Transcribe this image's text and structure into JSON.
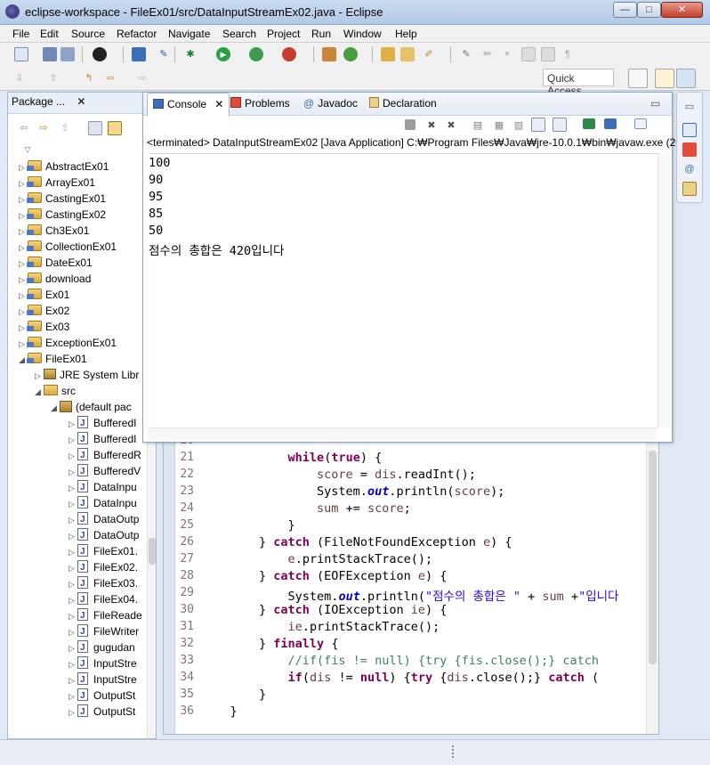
{
  "window": {
    "title": "eclipse-workspace - FileEx01/src/DataInputStreamEx02.java - Eclipse",
    "controls": {
      "minimize": "—",
      "maximize": "□",
      "close": "✕"
    }
  },
  "menu": [
    "File",
    "Edit",
    "Source",
    "Refactor",
    "Navigate",
    "Search",
    "Project",
    "Run",
    "Window",
    "Help"
  ],
  "quick_access": {
    "placeholder": "Quick Access"
  },
  "package_explorer": {
    "tab_label": "Package ...",
    "close_glyph": "✕",
    "items": [
      {
        "label": "AbstractEx01",
        "type": "project",
        "expanded": false
      },
      {
        "label": "ArrayEx01",
        "type": "project",
        "expanded": false
      },
      {
        "label": "CastingEx01",
        "type": "project",
        "expanded": false
      },
      {
        "label": "CastingEx02",
        "type": "project",
        "expanded": false
      },
      {
        "label": "Ch3Ex01",
        "type": "project",
        "expanded": false
      },
      {
        "label": "CollectionEx01",
        "type": "project",
        "expanded": false
      },
      {
        "label": "DateEx01",
        "type": "project",
        "expanded": false
      },
      {
        "label": "download",
        "type": "project",
        "expanded": false
      },
      {
        "label": "Ex01",
        "type": "project",
        "expanded": false
      },
      {
        "label": "Ex02",
        "type": "project",
        "expanded": false
      },
      {
        "label": "Ex03",
        "type": "project",
        "expanded": false
      },
      {
        "label": "ExceptionEx01",
        "type": "project",
        "expanded": false
      },
      {
        "label": "FileEx01",
        "type": "project",
        "expanded": true
      },
      {
        "label": "JRE System Libr",
        "type": "library",
        "expanded": false
      },
      {
        "label": "src",
        "type": "source",
        "expanded": true
      },
      {
        "label": "(default pac",
        "type": "package",
        "expanded": true
      },
      {
        "label": "BufferedI",
        "type": "file"
      },
      {
        "label": "BufferedI",
        "type": "file"
      },
      {
        "label": "BufferedR",
        "type": "file"
      },
      {
        "label": "BufferedV",
        "type": "file"
      },
      {
        "label": "DataInpu",
        "type": "file"
      },
      {
        "label": "DataInpu",
        "type": "file"
      },
      {
        "label": "DataOutp",
        "type": "file"
      },
      {
        "label": "DataOutp",
        "type": "file"
      },
      {
        "label": "FileEx01.",
        "type": "file"
      },
      {
        "label": "FileEx02.",
        "type": "file"
      },
      {
        "label": "FileEx03.",
        "type": "file"
      },
      {
        "label": "FileEx04.",
        "type": "file"
      },
      {
        "label": "FileReade",
        "type": "file"
      },
      {
        "label": "FileWriter",
        "type": "file"
      },
      {
        "label": "gugudan",
        "type": "file"
      },
      {
        "label": "InputStre",
        "type": "file"
      },
      {
        "label": "InputStre",
        "type": "file"
      },
      {
        "label": "OutputSt",
        "type": "file"
      },
      {
        "label": "OutputSt",
        "type": "file"
      }
    ]
  },
  "console": {
    "tabs": [
      {
        "label": "Console",
        "active": true
      },
      {
        "label": "Problems",
        "active": false
      },
      {
        "label": "Javadoc",
        "active": false
      },
      {
        "label": "Declaration",
        "active": false
      }
    ],
    "close_glyph": "✕",
    "status": "<terminated> DataInputStreamEx02 [Java Application] C:₩Program Files₩Java₩jre-10.0.1₩bin₩javaw.exe (20",
    "output": [
      "100",
      "90",
      "95",
      "85",
      "50",
      "점수의 총합은 420입니다"
    ]
  },
  "editor": {
    "line_numbers": [
      "20",
      "21",
      "22",
      "23",
      "24",
      "25",
      "26",
      "27",
      "28",
      "29",
      "30",
      "31",
      "32",
      "33",
      "34",
      "35",
      "36"
    ],
    "code_lines": [
      "",
      "            while(true) {",
      "                score = dis.readInt();",
      "                System.out.println(score);",
      "                sum += score;",
      "            }",
      "        } catch (FileNotFoundException e) {",
      "            e.printStackTrace();",
      "        } catch (EOFException e) {",
      "            System.out.println(\"점수의 총합은 \" + sum +\"입니다",
      "        } catch (IOException ie) {",
      "            ie.printStackTrace();",
      "        } finally {",
      "            //if(fis != null) {try {fis.close();} catch",
      "            if(dis != null) {try {dis.close();} catch (",
      "        }",
      "    }"
    ]
  }
}
